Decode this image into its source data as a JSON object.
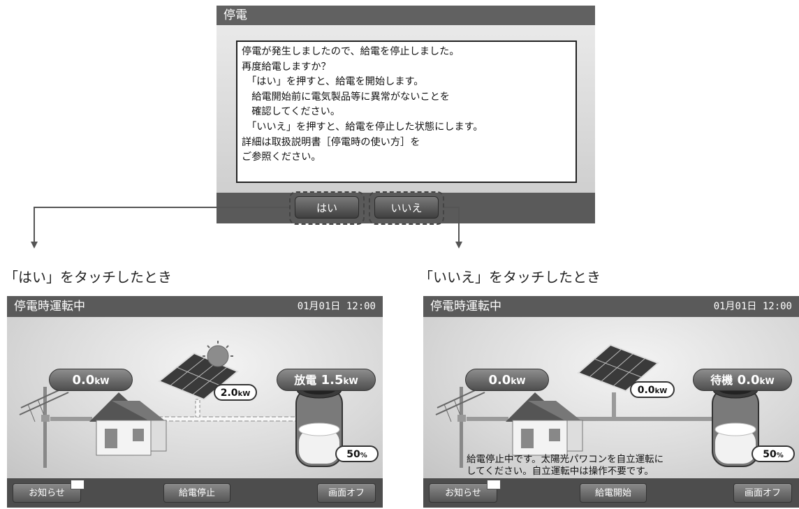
{
  "dialog": {
    "title": "停電",
    "message": "停電が発生しましたので、給電を停止しました。\n再度給電しますか？\n　「はい」を押すと、給電を開始します。\n　給電開始前に電気製品等に異常がないことを\n　確認してください。\n　「いいえ」を押すと、給電を停止した状態にします。\n詳細は取扱説明書［停電時の使い方］を\nご参照ください。",
    "yes_label": "はい",
    "no_label": "いいえ"
  },
  "captions": {
    "yes": "「はい」をタッチしたとき",
    "no": "「いいえ」をタッチしたとき"
  },
  "screen_yes": {
    "title": "停電時運転中",
    "datetime": "01月01日 12:00",
    "grid_value": "0.0",
    "grid_unit": "kW",
    "solar_value": "2.0",
    "solar_unit": "kW",
    "battery_status": "放電",
    "battery_value": "1.5",
    "battery_unit": "kW",
    "battery_percent": "50",
    "percent_unit": "%",
    "battery_level": 0.5,
    "footer": {
      "notice": "お知らせ",
      "action": "給電停止",
      "screen_off": "画面オフ"
    }
  },
  "screen_no": {
    "title": "停電時運転中",
    "datetime": "01月01日 12:00",
    "grid_value": "0.0",
    "grid_unit": "kW",
    "solar_value": "0.0",
    "solar_unit": "kW",
    "battery_status": "待機",
    "battery_value": "0.0",
    "battery_unit": "kW",
    "battery_percent": "50",
    "percent_unit": "%",
    "battery_level": 0.5,
    "message": "給電停止中です。太陽光パワコンを自立運転に\nしてください。自立運転中は操作不要です。",
    "footer": {
      "notice": "お知らせ",
      "action": "給電開始",
      "screen_off": "画面オフ"
    }
  },
  "colors": {
    "header": "#5a5a5a",
    "footer": "#4d4d4d",
    "button": "#4f4f4f"
  }
}
